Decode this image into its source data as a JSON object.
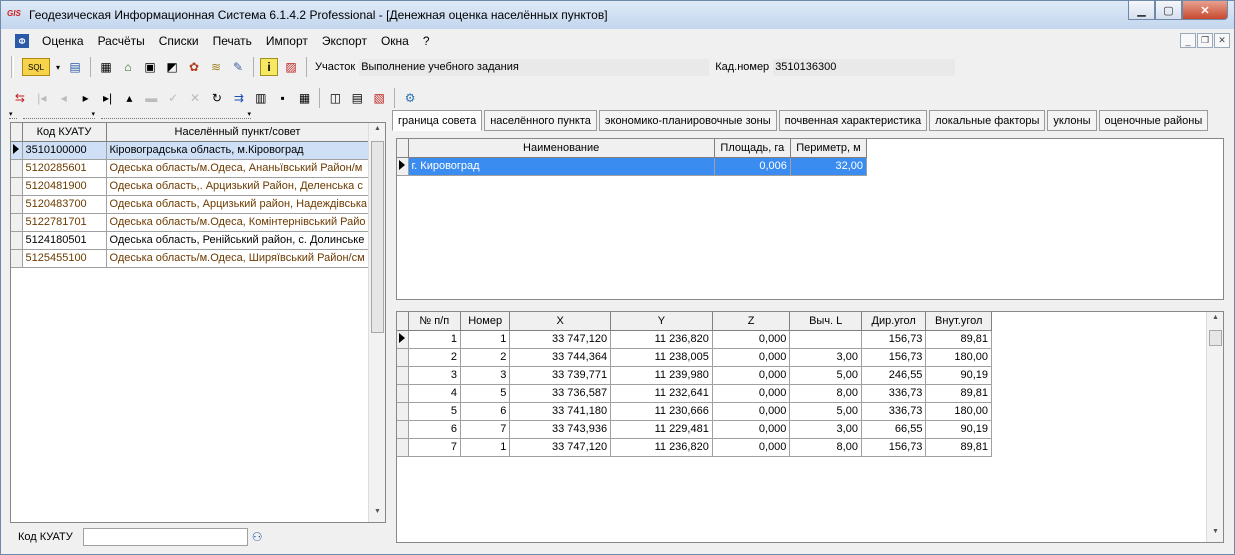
{
  "app": {
    "title": "Геодезическая Информационная Система 6.1.4.2 Professional - [Денежная оценка населённых пунктов]",
    "icon_text": "GIS"
  },
  "window_buttons": [
    "minimize-icon",
    "maximize-icon",
    "close-icon"
  ],
  "menu": {
    "items": [
      "Оценка",
      "Расчёты",
      "Списки",
      "Печать",
      "Импорт",
      "Экспорт",
      "Окна",
      "?"
    ]
  },
  "toolbar": {
    "uchastok_label": "Участок",
    "uchastok_value": "Выполнение учебного задания",
    "kad_label": "Кад.номер",
    "kad_value": "3510136300"
  },
  "left_grid": {
    "headers": [
      "Код КУАТУ",
      "Населённый пункт/совет"
    ],
    "rows": [
      {
        "code": "3510100000",
        "name": "Кіровоградська область, м.Кіровоград"
      },
      {
        "code": "5120285601",
        "name": "Одеська область/м.Одеса, Ананьївський Район/м"
      },
      {
        "code": "5120481900",
        "name": "Одеська область,. Арцизький Район, Деленська с"
      },
      {
        "code": "5120483700",
        "name": "Одеська область, Арцизький район, Надеждівська"
      },
      {
        "code": "5122781701",
        "name": "Одеська область/м.Одеса, Комінтернівський Райо"
      },
      {
        "code": "5124180501",
        "name": "Одеська область, Ренійський район, с. Долинське"
      },
      {
        "code": "5125455100",
        "name": "Одеська область/м.Одеса, Ширяївський Район/см"
      }
    ],
    "footer_label": "Код КУАТУ",
    "footer_input": ""
  },
  "tabs": [
    "граница совета",
    "населённого пункта",
    "экономико-планировочные зоны",
    "почвенная характеристика",
    "локальные факторы",
    "уклоны",
    "оценочные районы"
  ],
  "top_grid": {
    "headers": [
      "Наименование",
      "Площадь, га",
      "Периметр, м"
    ],
    "rows": [
      {
        "name": "г. Кировоград",
        "area": "0,006",
        "perimeter": "32,00"
      }
    ]
  },
  "points_grid": {
    "headers": [
      "№ п/п",
      "Номер",
      "X",
      "Y",
      "Z",
      "Выч. L",
      "Дир.угол",
      "Внут.угол"
    ],
    "rows": [
      [
        "1",
        "1",
        "33 747,120",
        "11 236,820",
        "0,000",
        "",
        "156,73",
        "89,81"
      ],
      [
        "2",
        "2",
        "33 744,364",
        "11 238,005",
        "0,000",
        "3,00",
        "156,73",
        "180,00"
      ],
      [
        "3",
        "3",
        "33 739,771",
        "11 239,980",
        "0,000",
        "5,00",
        "246,55",
        "90,19"
      ],
      [
        "4",
        "5",
        "33 736,587",
        "11 232,641",
        "0,000",
        "8,00",
        "336,73",
        "89,81"
      ],
      [
        "5",
        "6",
        "33 741,180",
        "11 230,666",
        "0,000",
        "5,00",
        "336,73",
        "180,00"
      ],
      [
        "6",
        "7",
        "33 743,936",
        "11 229,481",
        "0,000",
        "3,00",
        "66,55",
        "90,19"
      ],
      [
        "7",
        "1",
        "33 747,120",
        "11 236,820",
        "0,000",
        "8,00",
        "156,73",
        "89,81"
      ]
    ]
  }
}
